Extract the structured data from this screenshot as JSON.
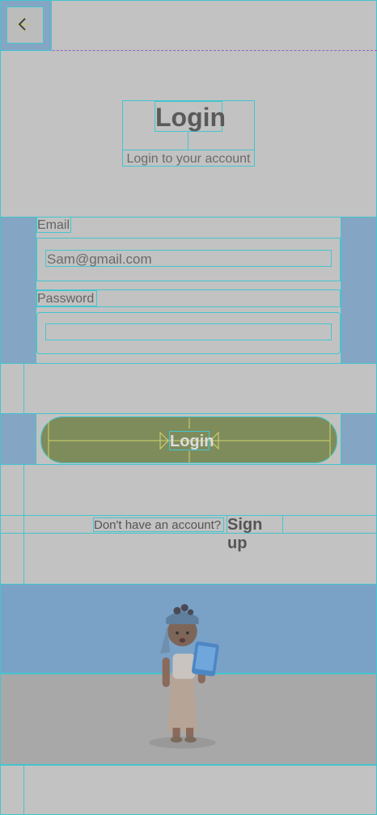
{
  "header": {
    "back_icon": "chevron-left-icon"
  },
  "hero": {
    "title": "Login",
    "subtitle": "Login to your account"
  },
  "form": {
    "email_label": "Email",
    "email_value": "Sam@gmail.com",
    "password_label": "Password",
    "password_value": ""
  },
  "actions": {
    "login_label": "Login"
  },
  "footer": {
    "question": "Don't have an account?",
    "signup_label": "Sign up"
  },
  "colors": {
    "button": "#7e8c5c",
    "panel": "#84a6c4",
    "guide": "#43c5cf",
    "background": "#c2c2c2"
  }
}
